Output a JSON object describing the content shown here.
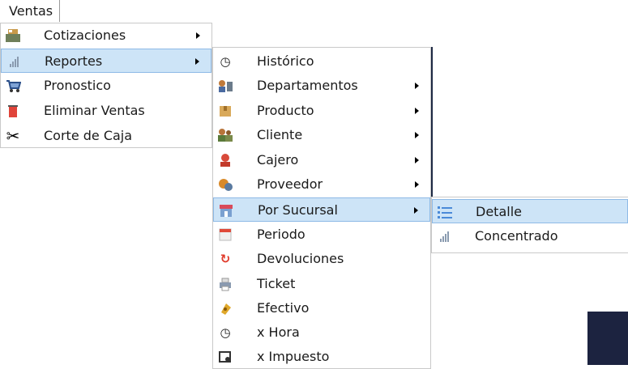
{
  "menubar": {
    "ventas": "Ventas"
  },
  "menu1": [
    {
      "label": "Cotizaciones",
      "icon": "register-icon",
      "submenu": true
    },
    {
      "label": "Reportes",
      "icon": "bar-chart-icon",
      "submenu": true,
      "highlighted": true
    },
    {
      "label": "Pronostico",
      "icon": "cart-icon",
      "submenu": false
    },
    {
      "label": "Eliminar Ventas",
      "icon": "trash-icon",
      "submenu": false
    },
    {
      "label": "Corte de Caja",
      "icon": "scissors-icon",
      "submenu": false
    }
  ],
  "menu2": [
    {
      "label": "Histórico",
      "icon": "history-icon",
      "submenu": false
    },
    {
      "label": "Departamentos",
      "icon": "departments-icon",
      "submenu": true
    },
    {
      "label": "Producto",
      "icon": "product-box-icon",
      "submenu": true
    },
    {
      "label": "Cliente",
      "icon": "client-icon",
      "submenu": true
    },
    {
      "label": "Cajero",
      "icon": "cashier-icon",
      "submenu": true
    },
    {
      "label": "Proveedor",
      "icon": "supplier-icon",
      "submenu": true
    },
    {
      "label": "Por Sucursal",
      "icon": "store-icon",
      "submenu": true,
      "highlighted": true
    },
    {
      "label": "Periodo",
      "icon": "calendar-icon",
      "submenu": false
    },
    {
      "label": "Devoluciones",
      "icon": "refresh-icon",
      "submenu": false
    },
    {
      "label": "Ticket",
      "icon": "printer-icon",
      "submenu": false
    },
    {
      "label": "Efectivo",
      "icon": "money-bag-icon",
      "submenu": false
    },
    {
      "label": "x Hora",
      "icon": "clock-history-icon",
      "submenu": false
    },
    {
      "label": "x Impuesto",
      "icon": "tax-icon",
      "submenu": false
    }
  ],
  "menu3": [
    {
      "label": "Detalle",
      "icon": "list-icon",
      "highlighted": true
    },
    {
      "label": "Concentrado",
      "icon": "bar-chart-icon"
    }
  ],
  "colors": {
    "highlight": "#cde4f7",
    "highlight_border": "#8ebae6",
    "dark": "#1c2340"
  }
}
